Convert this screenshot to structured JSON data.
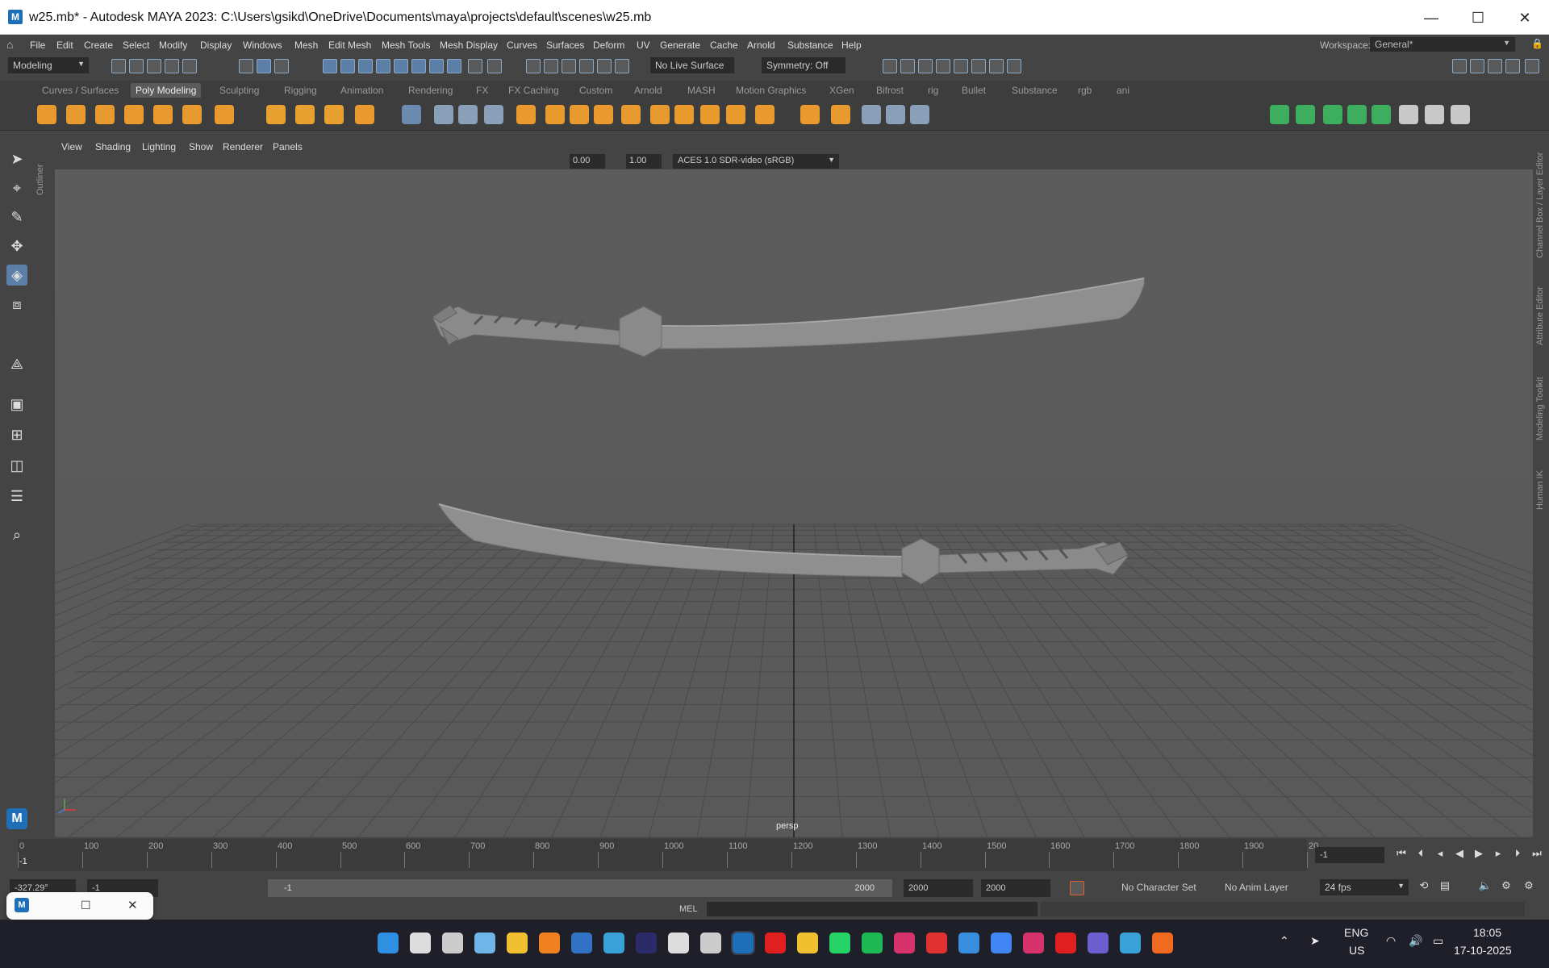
{
  "window": {
    "title": "w25.mb* - Autodesk MAYA 2023: C:\\Users\\gsikd\\OneDrive\\Documents\\maya\\projects\\default\\scenes\\w25.mb",
    "app_icon_letter": "M",
    "minimize": "—",
    "maximize": "☐",
    "close": "✕"
  },
  "menubar": {
    "items": [
      "File",
      "Edit",
      "Create",
      "Select",
      "Modify",
      "Display",
      "Windows",
      "Mesh",
      "Edit Mesh",
      "Mesh Tools",
      "Mesh Display",
      "Curves",
      "Surfaces",
      "Deform",
      "UV",
      "Generate",
      "Cache",
      "Arnold",
      "Substance",
      "Help"
    ],
    "workspace_label": "Workspace:",
    "workspace_value": "General*"
  },
  "statusline": {
    "mode": "Modeling",
    "live_surface": "No Live Surface",
    "symmetry": "Symmetry: Off"
  },
  "shelf": {
    "tabs": [
      "Curves / Surfaces",
      "Poly Modeling",
      "Sculpting",
      "Rigging",
      "Animation",
      "Rendering",
      "FX",
      "FX Caching",
      "Custom",
      "Arnold",
      "MASH",
      "Motion Graphics",
      "XGen",
      "Bifrost",
      "rig",
      "Bullet",
      "Substance",
      "rgb",
      "ani"
    ],
    "active_tab": "Poly Modeling",
    "icon_colors": [
      "#e89a2e",
      "#e89a2e",
      "#e89a2e",
      "#e89a2e",
      "#e89a2e",
      "#e89a2e",
      "#e89a2e",
      "#e8a02e",
      "#e8a02e",
      "#e8a02e",
      "#e89a2e",
      "#6a8ab0",
      "#8aa0b8",
      "#8aa0b8",
      "#8aa0b8",
      "#e89a2e",
      "#e89a2e",
      "#e89a2e",
      "#e89a2e",
      "#e89a2e",
      "#e89a2e",
      "#e89a2e",
      "#e89a2e",
      "#e89a2e",
      "#e89a2e",
      "#e89a2e",
      "#e89a2e",
      "#8aa0b8",
      "#8aa0b8",
      "#8aa0b8",
      "#3cae5e",
      "#3cae5e",
      "#3cae5e",
      "#3cae5e",
      "#3cae5e",
      "#c8c8c8",
      "#c8c8c8",
      "#c8c8c8"
    ]
  },
  "panel": {
    "menus": [
      "View",
      "Shading",
      "Lighting",
      "Show",
      "Renderer",
      "Panels"
    ],
    "exposure": "0.00",
    "gamma": "1.00",
    "colorspace": "ACES 1.0 SDR-video (sRGB)",
    "camera": "persp",
    "outliner_label": "Outliner"
  },
  "rightbar": {
    "tabs": [
      "Channel Box / Layer Editor",
      "Attribute Editor",
      "Modeling Toolkit",
      "Human IK"
    ]
  },
  "timeline": {
    "ticks": [
      "0",
      "100",
      "200",
      "300",
      "400",
      "500",
      "600",
      "700",
      "800",
      "900",
      "1000",
      "1100",
      "1200",
      "1300",
      "1400",
      "1500",
      "1600",
      "1700",
      "1800",
      "1900",
      "20"
    ],
    "current_marker": "-1",
    "current_frame": "-1"
  },
  "range": {
    "field_left": "-327.29°",
    "start": "-1",
    "slider_start": "-1",
    "slider_end": "2000",
    "end": "2000",
    "anim_end": "2000",
    "character_set": "No Character Set",
    "anim_layer": "No Anim Layer",
    "fps": "24 fps"
  },
  "cmdline": {
    "label": "MEL"
  },
  "taskbar": {
    "lang_top": "ENG",
    "lang_bottom": "US",
    "time": "18:05",
    "date": "17-10-2025",
    "app_colors": [
      "#2f8fe0",
      "#dddddd",
      "#cccccc",
      "#6fb5e8",
      "#f0c030",
      "#f08020",
      "#3172c4",
      "#3aa0d8",
      "#2b2b6a",
      "#dddddd",
      "#cccccc",
      "#1e6fb8",
      "#e02020",
      "#f0c030",
      "#25d366",
      "#1db954",
      "#d6336c",
      "#e03030",
      "#3a8ee0",
      "#4285f4",
      "#d6336c",
      "#e02020",
      "#6b5fd0",
      "#3aa0d8",
      "#f06a20"
    ]
  }
}
